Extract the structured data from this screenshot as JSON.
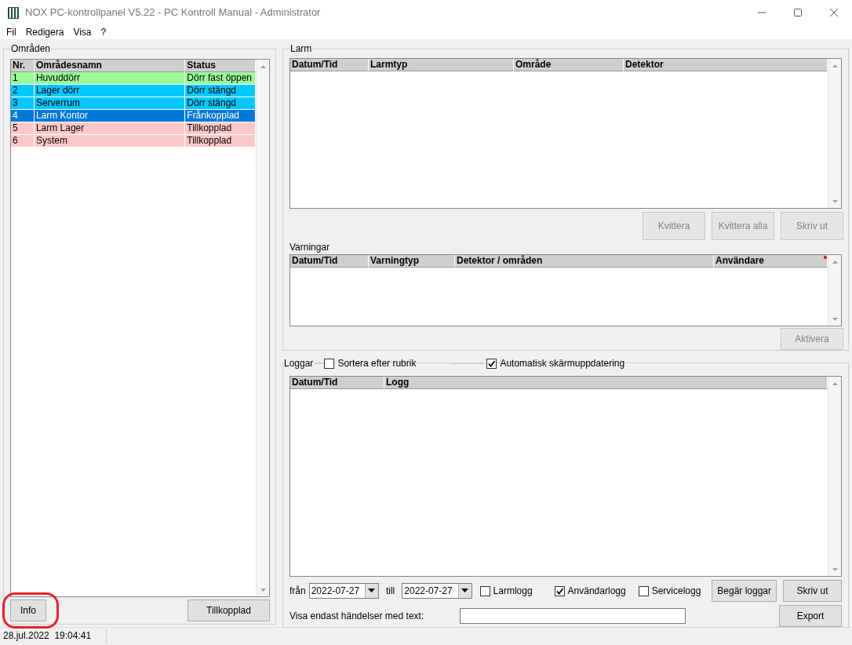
{
  "window": {
    "title": "NOX PC-kontrollpanel V5.22 - PC Kontroll Manual - Administrator"
  },
  "menu": [
    "Fil",
    "Redigera",
    "Visa",
    "?"
  ],
  "areas": {
    "title": "Områden",
    "columns": [
      "Nr.",
      "Områdesnamn",
      "Status"
    ],
    "rows": [
      {
        "cells": [
          "1",
          "Huvuddörr",
          "Dörr fast öppen"
        ],
        "selected": false,
        "color": "#98fb98"
      },
      {
        "cells": [
          "2",
          "Lager dörr",
          "Dörr stängd"
        ],
        "selected": false,
        "color": "#00c8ff"
      },
      {
        "cells": [
          "3",
          "Serverrum",
          "Dörr stängd"
        ],
        "selected": false,
        "color": "#00c8ff"
      },
      {
        "cells": [
          "4",
          "Larm Kontor",
          "Frånkopplad"
        ],
        "selected": true
      },
      {
        "cells": [
          "5",
          "Larm Lager",
          "Tillkopplad"
        ],
        "selected": false,
        "color": "#ffc8c8"
      },
      {
        "cells": [
          "6",
          "System",
          "Tillkopplad"
        ],
        "selected": false,
        "color": "#ffc8c8"
      }
    ],
    "buttons": [
      {
        "label": "Info",
        "highlighted": true
      },
      {
        "label": "Tillkopplad",
        "highlighted": false
      }
    ]
  },
  "alarms": {
    "title": "Larm",
    "columns": [
      "Datum/Tid",
      "Larmtyp",
      "Område",
      "Detektor"
    ],
    "buttons": [
      {
        "label": "Kvittera",
        "disabled": true
      },
      {
        "label": "Kvittera alla",
        "disabled": true
      },
      {
        "label": "Skriv ut",
        "disabled": true
      }
    ]
  },
  "warnings": {
    "title": "Varningar",
    "columns": [
      "Datum/Tid",
      "Varningtyp",
      "Detektor / områden",
      "Användare"
    ],
    "buttons": [
      {
        "label": "Aktivera",
        "disabled": true
      }
    ]
  },
  "logs": {
    "title": "Loggar",
    "options": [
      {
        "label": "Sortera efter rubrik",
        "checked": false
      },
      {
        "label": "Automatisk skärmuppdatering",
        "checked": true
      }
    ],
    "columns": [
      "Datum/Tid",
      "Logg"
    ],
    "from_label": "från",
    "from_date": "2022-07-27",
    "to_label": "till",
    "to_date": "2022-07-27",
    "filters": [
      {
        "label": "Larmlogg",
        "checked": false
      },
      {
        "label": "Användarlogg",
        "checked": true
      },
      {
        "label": "Servicelogg",
        "checked": false
      }
    ],
    "buttons": [
      {
        "label": "Begär loggar",
        "disabled": false
      },
      {
        "label": "Skriv ut",
        "disabled": false
      },
      {
        "label": "Export",
        "disabled": false
      }
    ],
    "text_filter_label": "Visa endast händelser med text:"
  },
  "status_bar": [
    "28.jul.2022  19:04:41"
  ]
}
